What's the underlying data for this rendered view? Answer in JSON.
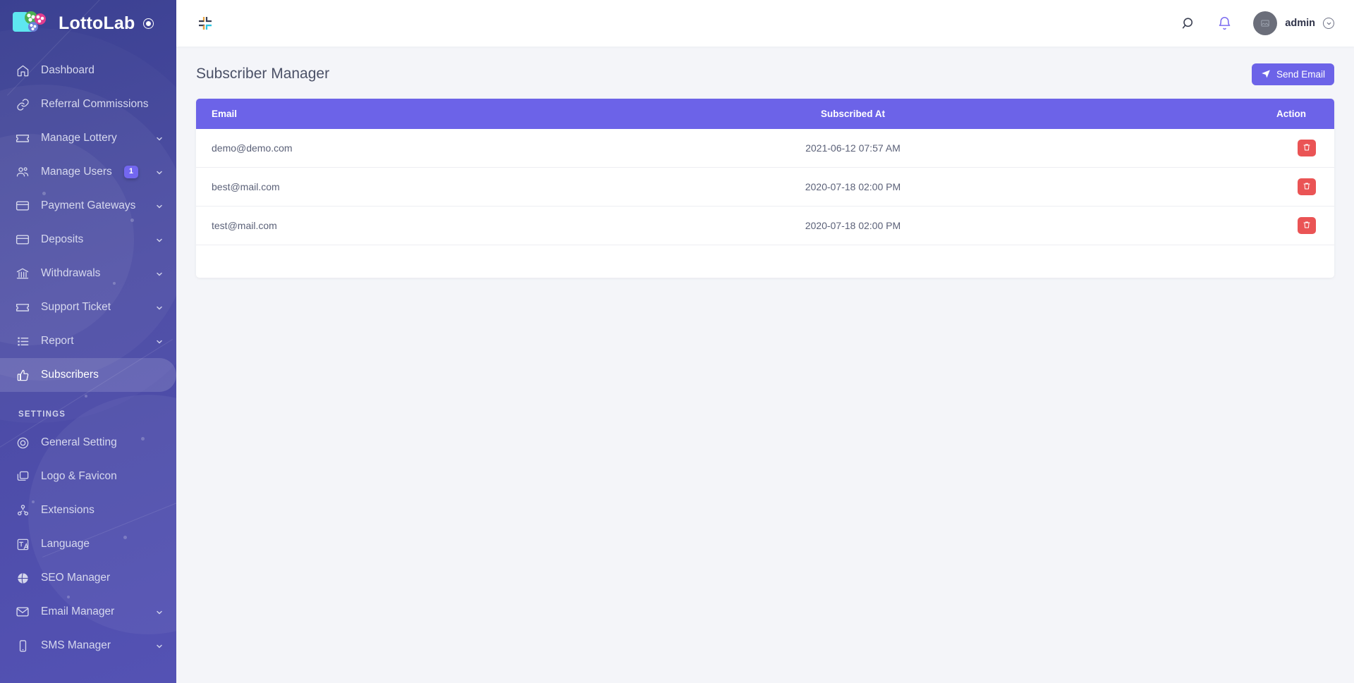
{
  "brand": {
    "name": "LottoLab",
    "mark": "registered-mark"
  },
  "topbar": {
    "collapse_label": "collapse-sidebar",
    "search_label": "Search",
    "notifications_label": "Notifications",
    "user_name": "admin"
  },
  "page": {
    "title": "Subscriber Manager",
    "send_email_label": "Send Email"
  },
  "sidebar": {
    "settings_section_label": "SETTINGS",
    "items": [
      {
        "label": "Dashboard",
        "icon": "home-icon",
        "caret": false,
        "badge": null,
        "active": false
      },
      {
        "label": "Referral Commissions",
        "icon": "link-icon",
        "caret": false,
        "badge": null,
        "active": false
      },
      {
        "label": "Manage Lottery",
        "icon": "ticket-icon",
        "caret": true,
        "badge": null,
        "active": false
      },
      {
        "label": "Manage Users",
        "icon": "users-icon",
        "caret": true,
        "badge": "1",
        "active": false
      },
      {
        "label": "Payment Gateways",
        "icon": "credit-card-icon",
        "caret": true,
        "badge": null,
        "active": false
      },
      {
        "label": "Deposits",
        "icon": "credit-card-icon",
        "caret": true,
        "badge": null,
        "active": false
      },
      {
        "label": "Withdrawals",
        "icon": "bank-icon",
        "caret": true,
        "badge": null,
        "active": false
      },
      {
        "label": "Support Ticket",
        "icon": "ticket-icon",
        "caret": true,
        "badge": null,
        "active": false
      },
      {
        "label": "Report",
        "icon": "list-icon",
        "caret": true,
        "badge": null,
        "active": false
      },
      {
        "label": "Subscribers",
        "icon": "thumbs-up-icon",
        "caret": false,
        "badge": null,
        "active": true
      }
    ],
    "settings_items": [
      {
        "label": "General Setting",
        "icon": "gear-icon",
        "caret": false,
        "badge": null,
        "active": false
      },
      {
        "label": "Logo & Favicon",
        "icon": "images-icon",
        "caret": false,
        "badge": null,
        "active": false
      },
      {
        "label": "Extensions",
        "icon": "nodes-icon",
        "caret": false,
        "badge": null,
        "active": false
      },
      {
        "label": "Language",
        "icon": "language-icon",
        "caret": false,
        "badge": null,
        "active": false
      },
      {
        "label": "SEO Manager",
        "icon": "globe-icon",
        "caret": false,
        "badge": null,
        "active": false
      },
      {
        "label": "Email Manager",
        "icon": "envelope-icon",
        "caret": true,
        "badge": null,
        "active": false
      },
      {
        "label": "SMS Manager",
        "icon": "mobile-icon",
        "caret": true,
        "badge": null,
        "active": false
      }
    ]
  },
  "table": {
    "columns": [
      "Email",
      "Subscribed At",
      "Action"
    ],
    "rows": [
      {
        "email": "demo@demo.com",
        "subscribed_at": "2021-06-12 07:57 AM",
        "action": "delete-button"
      },
      {
        "email": "best@mail.com",
        "subscribed_at": "2020-07-18 02:00 PM",
        "action": "delete-button"
      },
      {
        "email": "test@mail.com",
        "subscribed_at": "2020-07-18 02:00 PM",
        "action": "delete-button"
      }
    ]
  },
  "colors": {
    "sidebar_start": "#3b4191",
    "sidebar_end": "#5452b4",
    "accent_purple": "#6c63e8",
    "badge_purple": "#7367f0",
    "danger_red": "#ea5455",
    "page_bg": "#f4f5f9"
  }
}
